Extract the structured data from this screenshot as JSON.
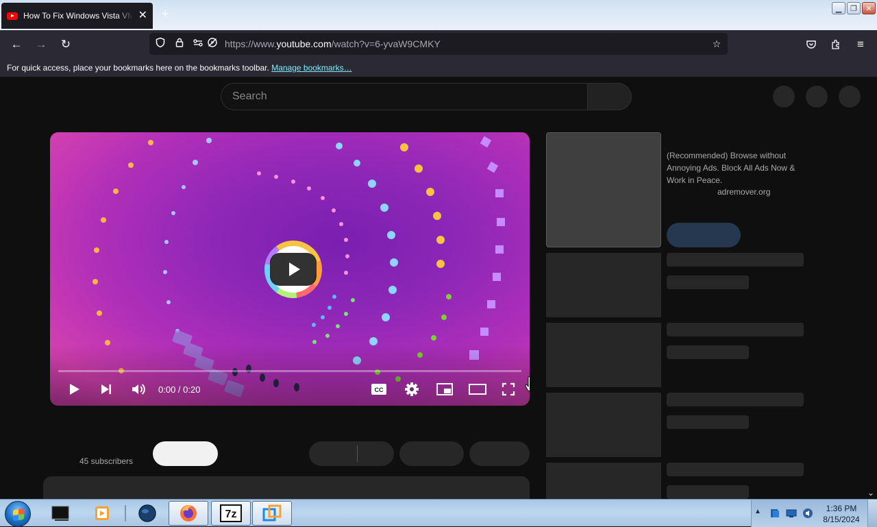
{
  "browser": {
    "tab_title": "How To Fix Windows Vista VMware",
    "tab_close": "✕",
    "new_tab": "+",
    "url_prefix": "https://www.",
    "url_host": "youtube.com",
    "url_path": "/watch?v=6-yvaW9CMKY",
    "bookmarks_text": "For quick access, place your bookmarks here on the bookmarks toolbar.",
    "manage_bookmarks": "Manage bookmarks…"
  },
  "youtube": {
    "search_placeholder": "Search",
    "player": {
      "time": "0:00 / 0:20",
      "progress_fraction": 0
    },
    "subscribers": "45 subscribers",
    "ad": {
      "text": "(Recommended) Browse without Annoying Ads. Block All Ads Now & Work in Peace.",
      "url": "adremover.org"
    }
  },
  "taskbar": {
    "clock_time": "1:36 PM",
    "clock_date": "8/15/2024",
    "apps": [
      "terminal-icon",
      "media-player-icon",
      "globe-icon",
      "firefox-icon",
      "7zip-icon",
      "vmware-icon"
    ],
    "sevenzip_label": "7z"
  },
  "colors": {
    "page_bg": "#0f0f0f",
    "browser_chrome": "#2b2a33",
    "link": "#80ebff",
    "youtube_red": "#ff0000"
  }
}
